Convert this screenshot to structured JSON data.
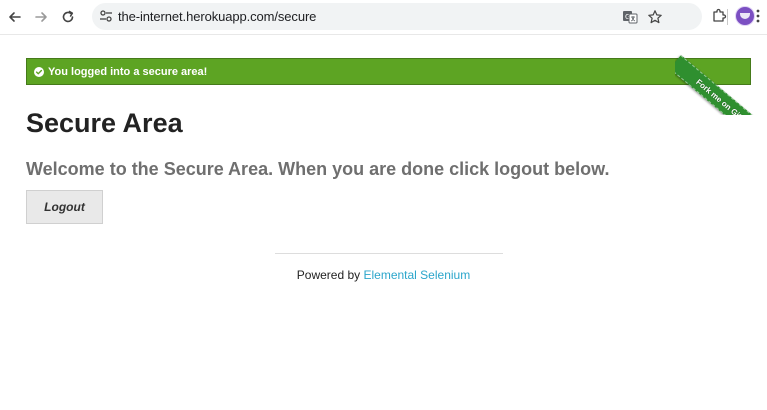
{
  "browser": {
    "url": "the-internet.herokuapp.com/secure",
    "icons": {
      "back": "arrow-left-icon",
      "forward": "arrow-right-icon",
      "reload": "reload-icon",
      "site_info": "tune-icon",
      "translate": "translate-icon",
      "bookmark": "star-icon",
      "extensions": "puzzle-icon",
      "menu": "kebab-menu-icon"
    }
  },
  "flash": {
    "message": "You logged into a secure area!",
    "close": "×",
    "color": "#5da423"
  },
  "page": {
    "title": "Secure Area",
    "subheader": "Welcome to the Secure Area. When you are done click logout below.",
    "logout_label": "Logout"
  },
  "ribbon": {
    "label": "Fork me on GitHub",
    "color": "#2f8f2f"
  },
  "footer": {
    "prefix": "Powered by ",
    "link_label": "Elemental Selenium",
    "link_color": "#2ba6cb"
  }
}
